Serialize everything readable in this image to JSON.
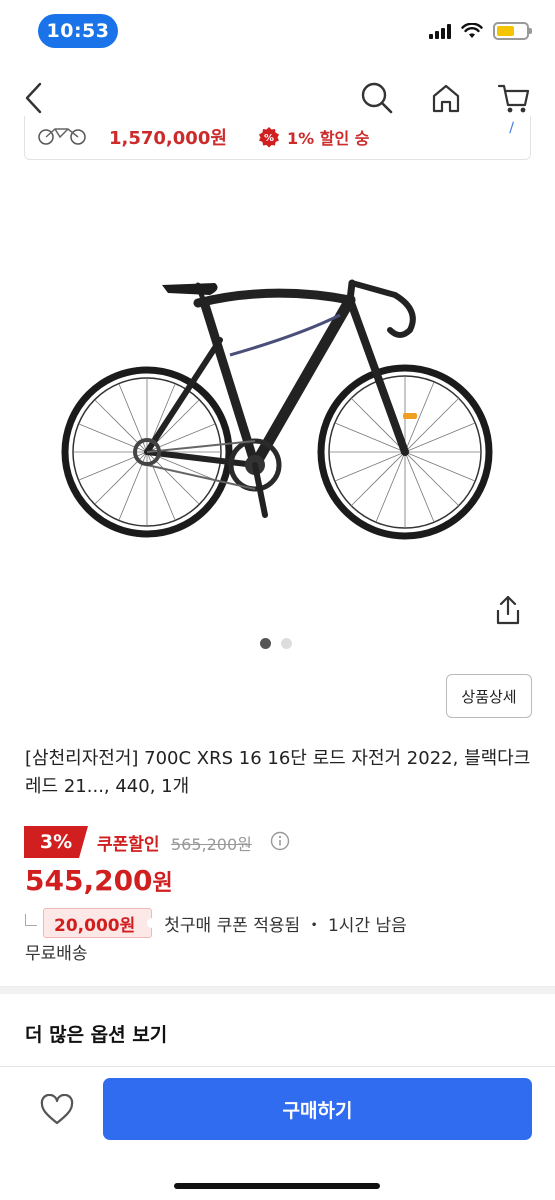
{
  "status_bar": {
    "time": "10:53"
  },
  "promo": {
    "price": "1,570,000원",
    "badge_text": "%",
    "discount_text": "1% 할인 숭"
  },
  "gallery": {
    "total_images": 2,
    "current_index": 1
  },
  "detail_button_label": "상품상세",
  "product": {
    "title": "[삼천리자전거] 700C XRS 16 16단 로드 자전거 2022, 블랙다크레드  21..., 440, 1개",
    "discount_percent": "3%",
    "coupon_label": "쿠폰할인",
    "original_price": "565,200원",
    "sale_price_number": "545,200",
    "sale_price_unit": "원",
    "coupon_amount": "20,000원",
    "coupon_info": "첫구매 쿠폰 적용됨 ・ 1시간 남음",
    "shipping": "무료배송"
  },
  "more_options_label": "더 많은 옵션 보기",
  "buy_button_label": "구매하기",
  "colors": {
    "accent_blue": "#2f6cf0",
    "sale_red": "#d11f1f",
    "time_pill": "#1a73e8"
  },
  "icons": [
    "back-icon",
    "search-icon",
    "home-icon",
    "cart-icon",
    "share-icon",
    "info-icon",
    "heart-icon",
    "wifi-icon",
    "signal-icon",
    "battery-icon"
  ]
}
